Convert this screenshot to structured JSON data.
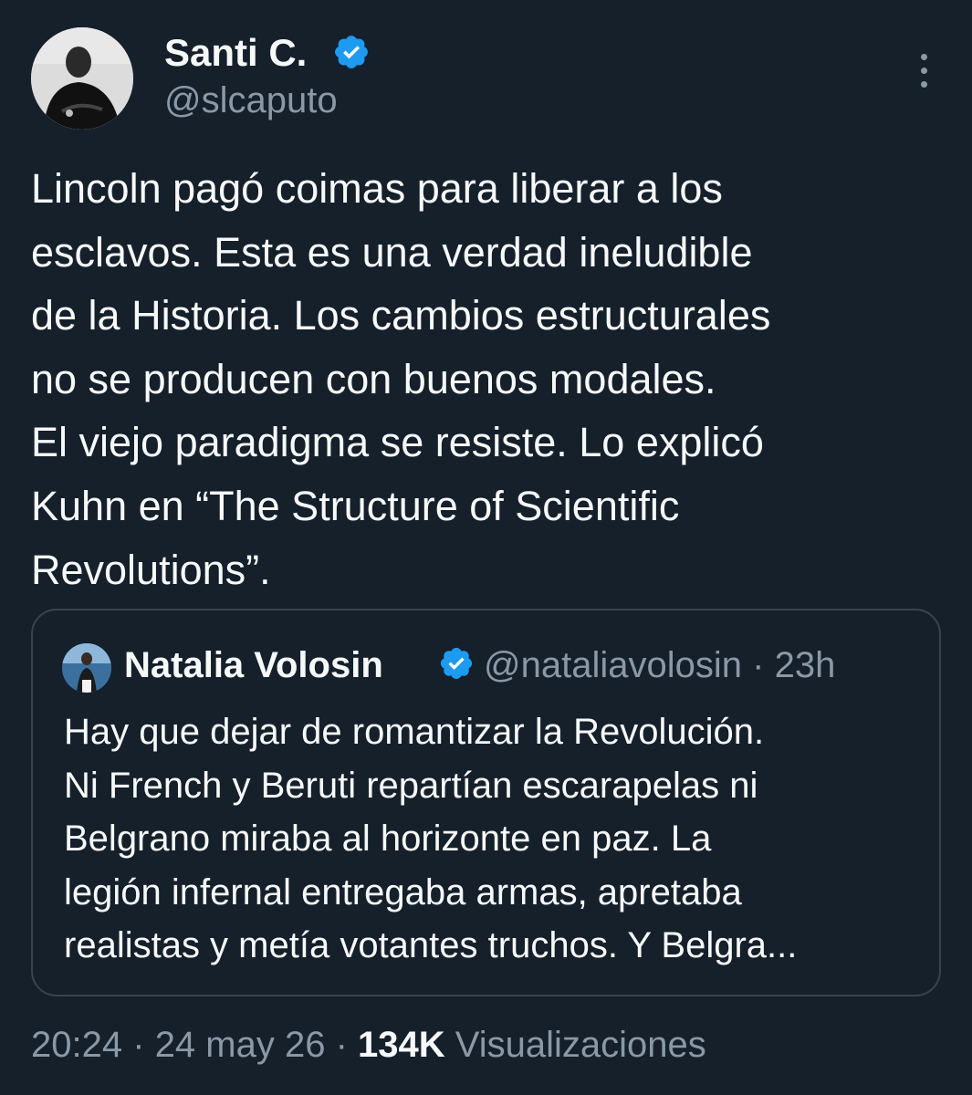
{
  "author": {
    "name": "Santi C.",
    "handle": "@slcaputo"
  },
  "tweet": {
    "text": "Lincoln pagó coimas para liberar a los\nesclavos. Esta es una verdad ineludible\nde la Historia. Los cambios estructurales\nno se producen con buenos modales.\nEl viejo paradigma se resiste. Lo explicó\nKuhn en “The Structure of Scientific\nRevolutions”."
  },
  "quote": {
    "name": "Natalia Volosin",
    "handle": "@nataliavolosin",
    "separator": "·",
    "time": "23h",
    "text": "Hay que dejar de romantizar la Revolución.\nNi French y Beruti repartían escarapelas ni\nBelgrano miraba al horizonte en paz. La\nlegión infernal entregaba armas, apretaba\nrealistas y metía votantes truchos. Y Belgra..."
  },
  "meta": {
    "time": "20:24",
    "sep1": "·",
    "date": "24 may 26",
    "sep2": "·",
    "views_count": "134K",
    "views_label": "Visualizaciones"
  },
  "colors": {
    "background": "#15202b",
    "text": "#f7f9f9",
    "secondary": "#8b98a5",
    "verified": "#1d9bf0",
    "border": "#38444d"
  },
  "icons": {
    "verified": "verified-badge-icon",
    "more": "more-dots-icon"
  }
}
